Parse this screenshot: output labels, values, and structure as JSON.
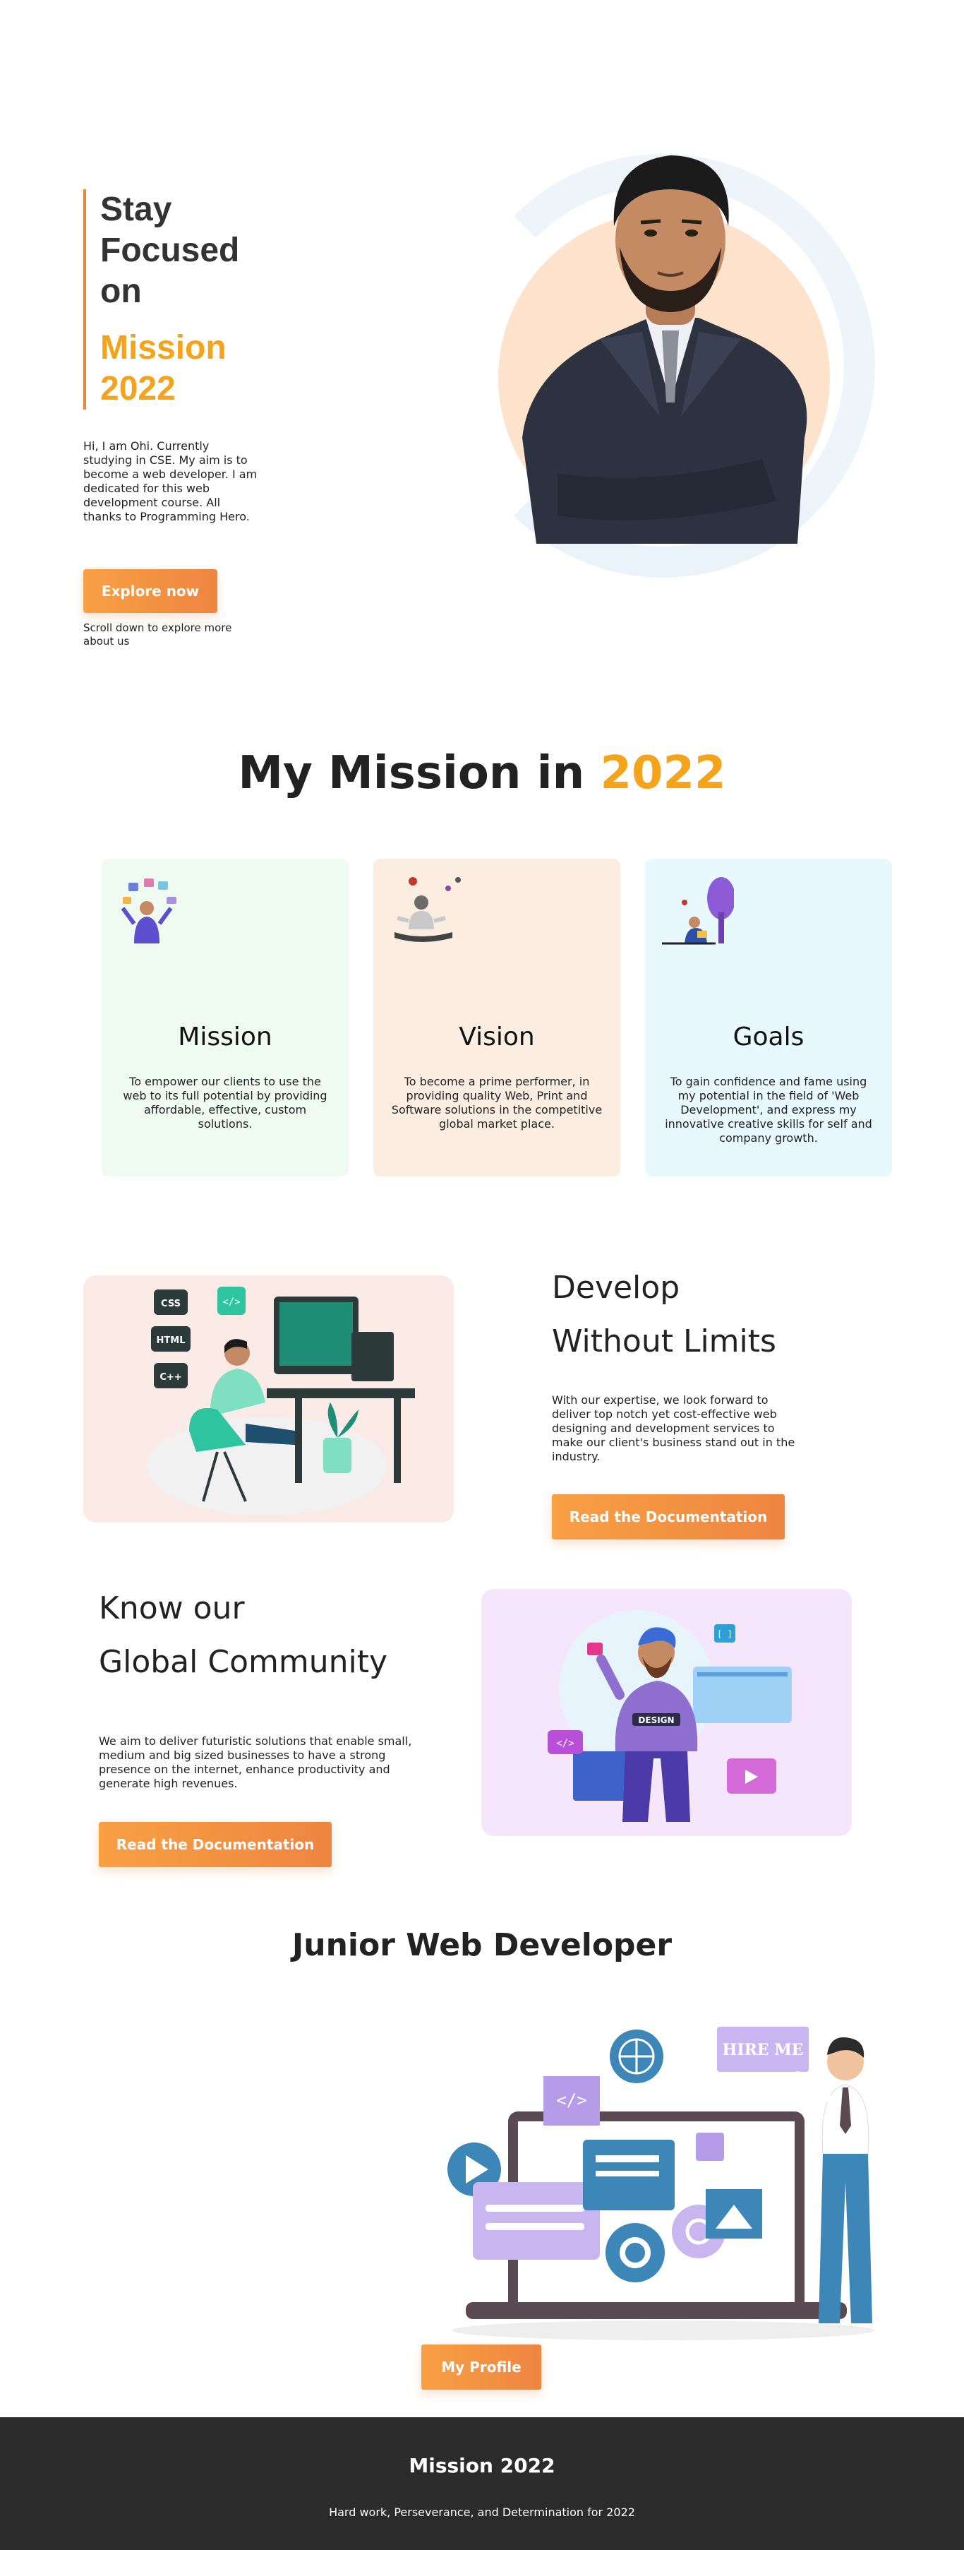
{
  "hero": {
    "title_lines": [
      "Stay",
      "Focused",
      "on"
    ],
    "accent_lines": [
      "Mission",
      "2022"
    ],
    "description": "Hi, I am Ohi. Currently studying in CSE. My aim is to become a web developer. I am dedicated for this web development course. All thanks to Programming Hero.",
    "button_label": "Explore now",
    "scroll_text": "Scroll down to explore more about us"
  },
  "mission_section": {
    "title_prefix": "My Mission in",
    "title_year": "2022",
    "cards": [
      {
        "title": "Mission",
        "text": "To empower our clients to use the web to its full potential by providing affordable, effective, custom solutions.",
        "bg": "#effaf0"
      },
      {
        "title": "Vision",
        "text": "To become a prime performer, in providing quality Web, Print and Software solutions in the competitive global market place.",
        "bg": "#fbeee1"
      },
      {
        "title": "Goals",
        "text": "To gain confidence and fame using my potential in the field of 'Web Development', and express my innovative creative skills for self and company growth.",
        "bg": "#e8f9fd"
      }
    ]
  },
  "develop": {
    "heading_lines": [
      "Develop",
      "Without Limits"
    ],
    "text": "With our expertise, we look forward to deliver top notch yet cost-effective web designing and development services to make our client's business stand out in the industry.",
    "button_label": "Read the Documentation",
    "code_tags": [
      "CSS",
      "HTML",
      "C++"
    ]
  },
  "community": {
    "heading_lines": [
      "Know our",
      "Global Community"
    ],
    "text": "We aim to deliver futuristic solutions that enable small, medium and big sized businesses to have a strong presence on the internet, enhance productivity and generate high revenues.",
    "button_label": "Read the Documentation",
    "shirt_label": "DESIGN"
  },
  "junior": {
    "title": "Junior Web Developer",
    "hire_sign": "HIRE ME",
    "button_label": "My Profile"
  },
  "footer": {
    "title": "Mission 2022",
    "subtitle": "Hard work, Perseverance, and Determination for 2022"
  },
  "colors": {
    "accent": "#f5a31a",
    "button": "#ee8540",
    "footer_bg": "#2b2b2b"
  }
}
